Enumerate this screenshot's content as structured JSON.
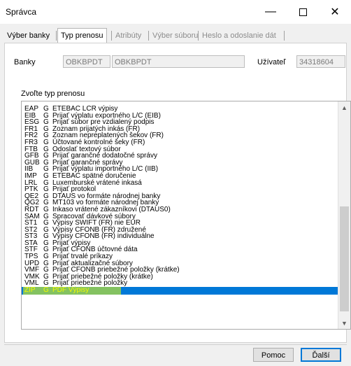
{
  "window": {
    "title": "Správca",
    "minimize_glyph": "—",
    "close_glyph": "✕"
  },
  "tabs": [
    {
      "label": "Výber banky",
      "active": false,
      "enabled": true
    },
    {
      "label": "Typ prenosu",
      "active": true,
      "enabled": true
    },
    {
      "label": "Atribúty",
      "active": false,
      "enabled": false
    },
    {
      "label": "Výber súboru",
      "active": false,
      "enabled": false
    },
    {
      "label": "Heslo a odoslanie dát",
      "active": false,
      "enabled": false
    }
  ],
  "form": {
    "bank_label": "Banky",
    "bank_code": "OBKBPDT",
    "bank_name": "OBKBPDT",
    "user_label": "Užívateľ",
    "user_value": "34318604",
    "list_caption": "Zvoľte typ prenosu"
  },
  "list": {
    "items": [
      {
        "code": "EAP",
        "flag": "G",
        "desc": "ETEBAC LCR výpisy"
      },
      {
        "code": "EIB",
        "flag": "G",
        "desc": "Prijať výplatu exportného L/C (EIB)"
      },
      {
        "code": "ESG",
        "flag": "G",
        "desc": "Prijať súbor pre vzdialený podpis"
      },
      {
        "code": "FR1",
        "flag": "G",
        "desc": "Zoznam prijatých inkás (FR)"
      },
      {
        "code": "FR2",
        "flag": "G",
        "desc": "Zoznam nepreplatených šekov (FR)"
      },
      {
        "code": "FR3",
        "flag": "G",
        "desc": "Účtované kontrolné šeky (FR)"
      },
      {
        "code": "FTB",
        "flag": "G",
        "desc": "Odoslať textový súbor"
      },
      {
        "code": "GFB",
        "flag": "G",
        "desc": "Prijať garančné dodatočné správy"
      },
      {
        "code": "GUB",
        "flag": "G",
        "desc": "Prijať garančné správy"
      },
      {
        "code": "IIB",
        "flag": "G",
        "desc": "Prijať výplatu importného L/C (IIB)"
      },
      {
        "code": "IMP",
        "flag": "G",
        "desc": "ETEBAC spätné doručenie"
      },
      {
        "code": "LRL",
        "flag": "G",
        "desc": "Luxemburské vrátené inkasá"
      },
      {
        "code": "PTK",
        "flag": "G",
        "desc": "Prijať protokol"
      },
      {
        "code": "QE2",
        "flag": "G",
        "desc": "DTAUS vo formáte národnej banky"
      },
      {
        "code": "QG2",
        "flag": "G",
        "desc": "MT103 vo formáte národnej banky"
      },
      {
        "code": "RDT",
        "flag": "G",
        "desc": "Inkaso vrátené zákazníkovi (DTAUS0)"
      },
      {
        "code": "SAM",
        "flag": "G",
        "desc": "Spracovať dávkové súbory"
      },
      {
        "code": "ST1",
        "flag": "G",
        "desc": "Výpisy SWIFT (FR) nie EUR"
      },
      {
        "code": "ST2",
        "flag": "G",
        "desc": "Výpisy CFONB (FR) združené"
      },
      {
        "code": "ST3",
        "flag": "G",
        "desc": "Výpisy CFONB (FR) individuálne"
      },
      {
        "code": "STA",
        "flag": "G",
        "desc": "Prijať výpisy"
      },
      {
        "code": "STF",
        "flag": "G",
        "desc": "Prijať CFONB účtovné dáta"
      },
      {
        "code": "TPS",
        "flag": "G",
        "desc": "Prijať trvalé príkazy"
      },
      {
        "code": "UPD",
        "flag": "G",
        "desc": "Prijať aktualizačné súbory"
      },
      {
        "code": "VMF",
        "flag": "G",
        "desc": "Prijať CFONB priebežné položky (krátke)"
      },
      {
        "code": "VMK",
        "flag": "G",
        "desc": "Prijať priebežné položky (krátke)"
      },
      {
        "code": "VML",
        "flag": "G",
        "desc": "Prijať priebežné položky"
      },
      {
        "code": "ZIP",
        "flag": "G",
        "desc": "PDF Výpisy",
        "selected": true
      }
    ]
  },
  "buttons": {
    "help": "Pomoc",
    "next": "Ďalší"
  },
  "colors": {
    "selection": "#0078d7",
    "highlighter": "#f0ff00"
  }
}
